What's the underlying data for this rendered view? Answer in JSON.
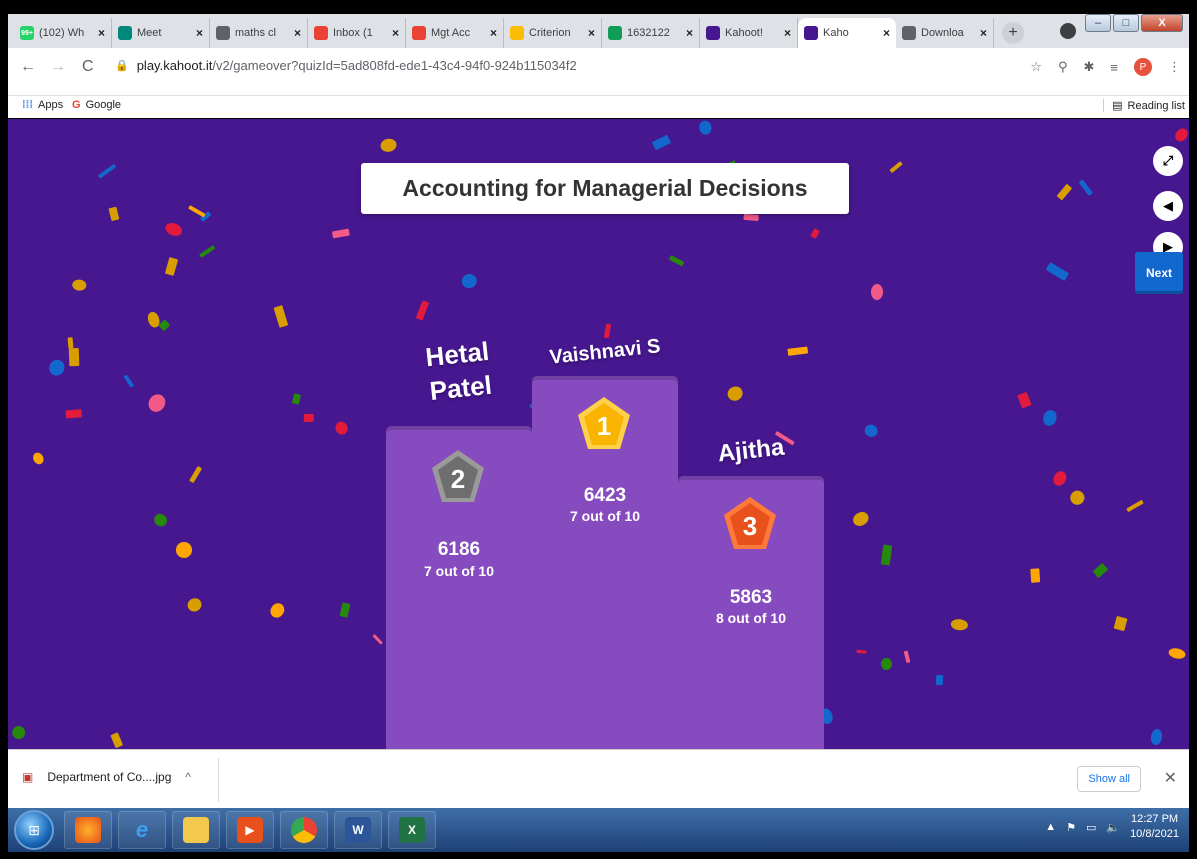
{
  "browser": {
    "tabs": [
      {
        "label": "(102) Wh",
        "icon": "whatsapp-icon",
        "color": "#25d366",
        "badge": "99+"
      },
      {
        "label": "Meet",
        "icon": "meet-icon",
        "color": "#00897b"
      },
      {
        "label": "maths cl",
        "icon": "globe-icon",
        "color": "#5f6368"
      },
      {
        "label": "Inbox (1",
        "icon": "gmail-icon",
        "color": "#ea4335"
      },
      {
        "label": "Mgt Acc",
        "icon": "gmail-icon",
        "color": "#ea4335"
      },
      {
        "label": "Criterion",
        "icon": "drive-icon",
        "color": "#fbbc04"
      },
      {
        "label": "1632122",
        "icon": "sheets-icon",
        "color": "#0f9d58"
      },
      {
        "label": "Kahoot!",
        "icon": "kahoot-icon",
        "color": "#46178f"
      },
      {
        "label": "Kaho",
        "icon": "kahoot-icon",
        "color": "#46178f",
        "active": true
      },
      {
        "label": "Downloa",
        "icon": "globe-icon",
        "color": "#5f6368"
      }
    ],
    "url_host": "play.kahoot.it",
    "url_path": "/v2/gameover?quizId=5ad808fd-ede1-43c4-94f0-924b115034f2",
    "profile_initial": "P",
    "bookmarks": {
      "apps": "Apps",
      "google": "Google",
      "reading_list": "Reading list"
    }
  },
  "game": {
    "title": "Accounting for Managerial Decisions",
    "next_label": "Next",
    "podium": [
      {
        "rank": "1",
        "name": "Vaishnavi S",
        "score": "6423",
        "correct": "7 out of 10",
        "medal_color": "#f8b400"
      },
      {
        "rank": "2",
        "name_line1": "Hetal",
        "name_line2": "Patel",
        "score": "6186",
        "correct": "7 out of 10",
        "medal_color": "#6e6e6e"
      },
      {
        "rank": "3",
        "name": "Ajitha",
        "score": "5863",
        "correct": "8 out of 10",
        "medal_color": "#e8501c"
      }
    ]
  },
  "downloads": {
    "file": "Department of Co....jpg",
    "show_all": "Show all"
  },
  "taskbar": {
    "time": "12:27 PM",
    "date": "10/8/2021"
  },
  "colors": {
    "kahoot_purple": "#46178f",
    "podium_purple": "#864cbf",
    "next_blue": "#1368ce"
  }
}
